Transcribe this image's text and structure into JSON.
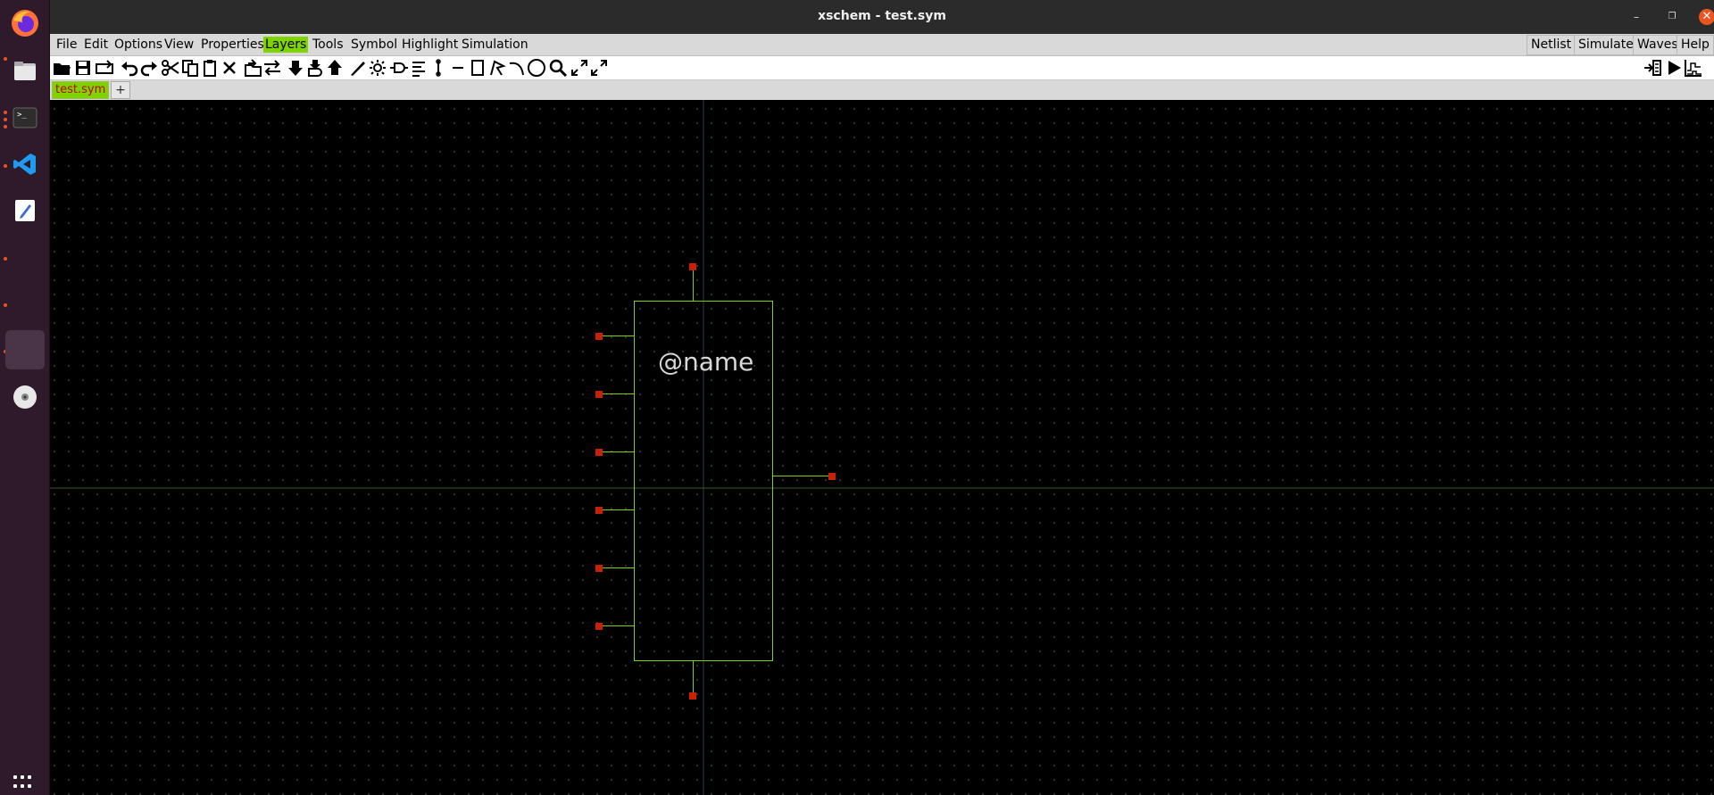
{
  "window": {
    "title": "xschem - test.sym"
  },
  "dock": {
    "items": [
      "firefox-icon",
      "files-icon",
      "terminal-icon",
      "vscode-icon",
      "text-editor-icon",
      "app-6-icon",
      "app-7-icon",
      "app-8-icon",
      "disc-icon"
    ],
    "show_apps_icon": "show-applications-icon"
  },
  "menu": {
    "items": [
      "File",
      "Edit",
      "Options",
      "View",
      "Properties",
      "Layers",
      "Tools",
      "Symbol",
      "Highlight",
      "Simulation"
    ],
    "highlighted": "Layers",
    "right_items": [
      "Netlist",
      "Simulate",
      "Waves",
      "Help"
    ]
  },
  "toolbar": {
    "icons": [
      "open-icon",
      "save-icon",
      "reload-icon",
      "undo-icon",
      "redo-icon",
      "cut-icon",
      "copy-icon",
      "paste-icon",
      "delete-icon",
      "insert-symbol-icon",
      "swap-icon",
      "descend-icon",
      "descend-symbol-icon",
      "go-up-icon",
      "draw-wire-icon",
      "highlight-icon",
      "add-pin-icon",
      "align-icon",
      "add-bus-icon",
      "line-icon",
      "rectangle-icon",
      "polygon-icon",
      "arc-icon",
      "circle-icon",
      "zoom-icon",
      "zoom-full-icon",
      "zoom-fit-icon"
    ],
    "right_icons": [
      "netlist-icon",
      "simulate-icon",
      "waves-icon"
    ]
  },
  "tabs": {
    "active": "test.sym",
    "add_label": "+"
  },
  "canvas": {
    "symbol_label": "@name",
    "colors": {
      "background": "#000000",
      "symbol": "#7fd300",
      "pin": "#c82000",
      "axis": "#3d5a26",
      "grid": "#3a3a3a",
      "label": "#d8d8d8"
    }
  }
}
